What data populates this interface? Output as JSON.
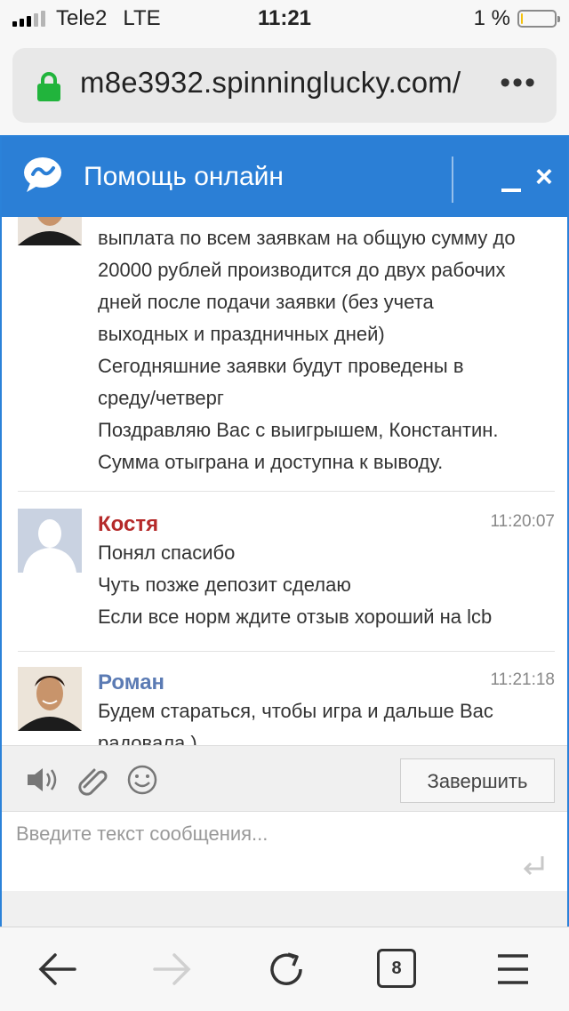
{
  "status_bar": {
    "carrier": "Tele2",
    "network": "LTE",
    "time": "11:21",
    "battery_text": "1 %",
    "battery_level": 0.05
  },
  "browser": {
    "url": "m8e3932.spinninglucky.com/",
    "menu_label": "•••",
    "tabs_count": "8",
    "icons": [
      "lock-icon",
      "back-arrow-icon",
      "forward-arrow-icon",
      "reload-icon",
      "tabs-icon",
      "menu-icon"
    ]
  },
  "chat": {
    "title": "Помощь онлайн",
    "close_label": "×",
    "accent": "#2b7fd6",
    "messages": [
      {
        "author": "",
        "time": "",
        "lines": [
          "выплата по всем заявкам на общую сумму до",
          "20000 рублей производится до двух рабочих",
          "дней после подачи заявки (без учета",
          "выходных и праздничных дней)",
          "Сегодняшние заявки будут проведены в",
          "среду/четверг",
          "Поздравляю Вас с выигрышем, Константин.",
          "Сумма отыграна и доступна к выводу."
        ]
      },
      {
        "author": "Костя",
        "author_color": "#b52a2a",
        "time": "11:20:07",
        "lines": [
          "Понял спасибо",
          "Чуть позже депозит сделаю",
          "Если все норм ждите отзыв хороший на lcb"
        ]
      },
      {
        "author": "Роман",
        "author_color": "#5b7bb4",
        "time": "11:21:18",
        "lines": [
          "Будем стараться, чтобы игра и дальше Вас",
          "радовала )"
        ]
      }
    ],
    "toolbar": {
      "finish_label": "Завершить",
      "icons": [
        "sound-icon",
        "attach-icon",
        "smile-icon"
      ]
    },
    "input": {
      "placeholder": "Введите текст сообщения..."
    }
  }
}
